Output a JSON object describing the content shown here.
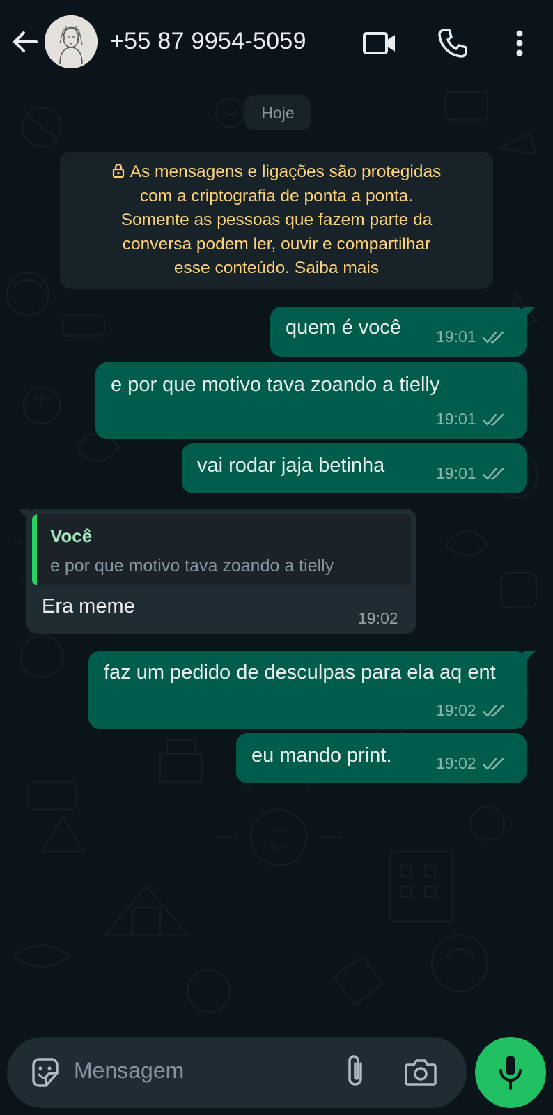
{
  "header": {
    "contact_name": "+55 87 9954-5059",
    "icons": [
      "back-arrow-icon",
      "avatar",
      "video-call-icon",
      "phone-icon",
      "more-vert-icon"
    ]
  },
  "chat": {
    "date_chip": "Hoje",
    "encryption_notice": {
      "lines": [
        "As mensagens e ligações são protegidas",
        "com a criptografia de ponta a ponta.",
        "Somente as pessoas que fazem parte da",
        "conversa podem ler, ouvir e compartilhar",
        "esse conteúdo. Saiba mais"
      ]
    },
    "messages": [
      {
        "direction": "outgoing",
        "text": "quem é você",
        "time": "19:01",
        "status": "read"
      },
      {
        "direction": "outgoing",
        "text": "e por que motivo tava zoando a tielly",
        "time": "19:01",
        "status": "read"
      },
      {
        "direction": "outgoing",
        "text": "vai rodar jaja betinha",
        "time": "19:01",
        "status": "read"
      },
      {
        "direction": "incoming",
        "quote_author": "Você",
        "quote_text": "e por que motivo tava zoando a tielly",
        "text": "Era meme",
        "time": "19:02"
      },
      {
        "direction": "outgoing",
        "text": "faz um pedido de desculpas para ela aq ent",
        "time": "19:02",
        "status": "read"
      },
      {
        "direction": "outgoing",
        "text": "eu mando print.",
        "time": "19:02",
        "status": "read"
      }
    ]
  },
  "composer": {
    "placeholder": "Mensagem",
    "icons": [
      "sticker-icon",
      "attach-clip-icon",
      "camera-icon",
      "microphone-icon"
    ]
  },
  "colors": {
    "background": "#0b141a",
    "outgoing_bubble": "#005c4b",
    "incoming_bubble": "#202c33",
    "notice_text": "#ffd279",
    "accent_green": "#21c063",
    "read_ticks": "#8fb7ad"
  }
}
